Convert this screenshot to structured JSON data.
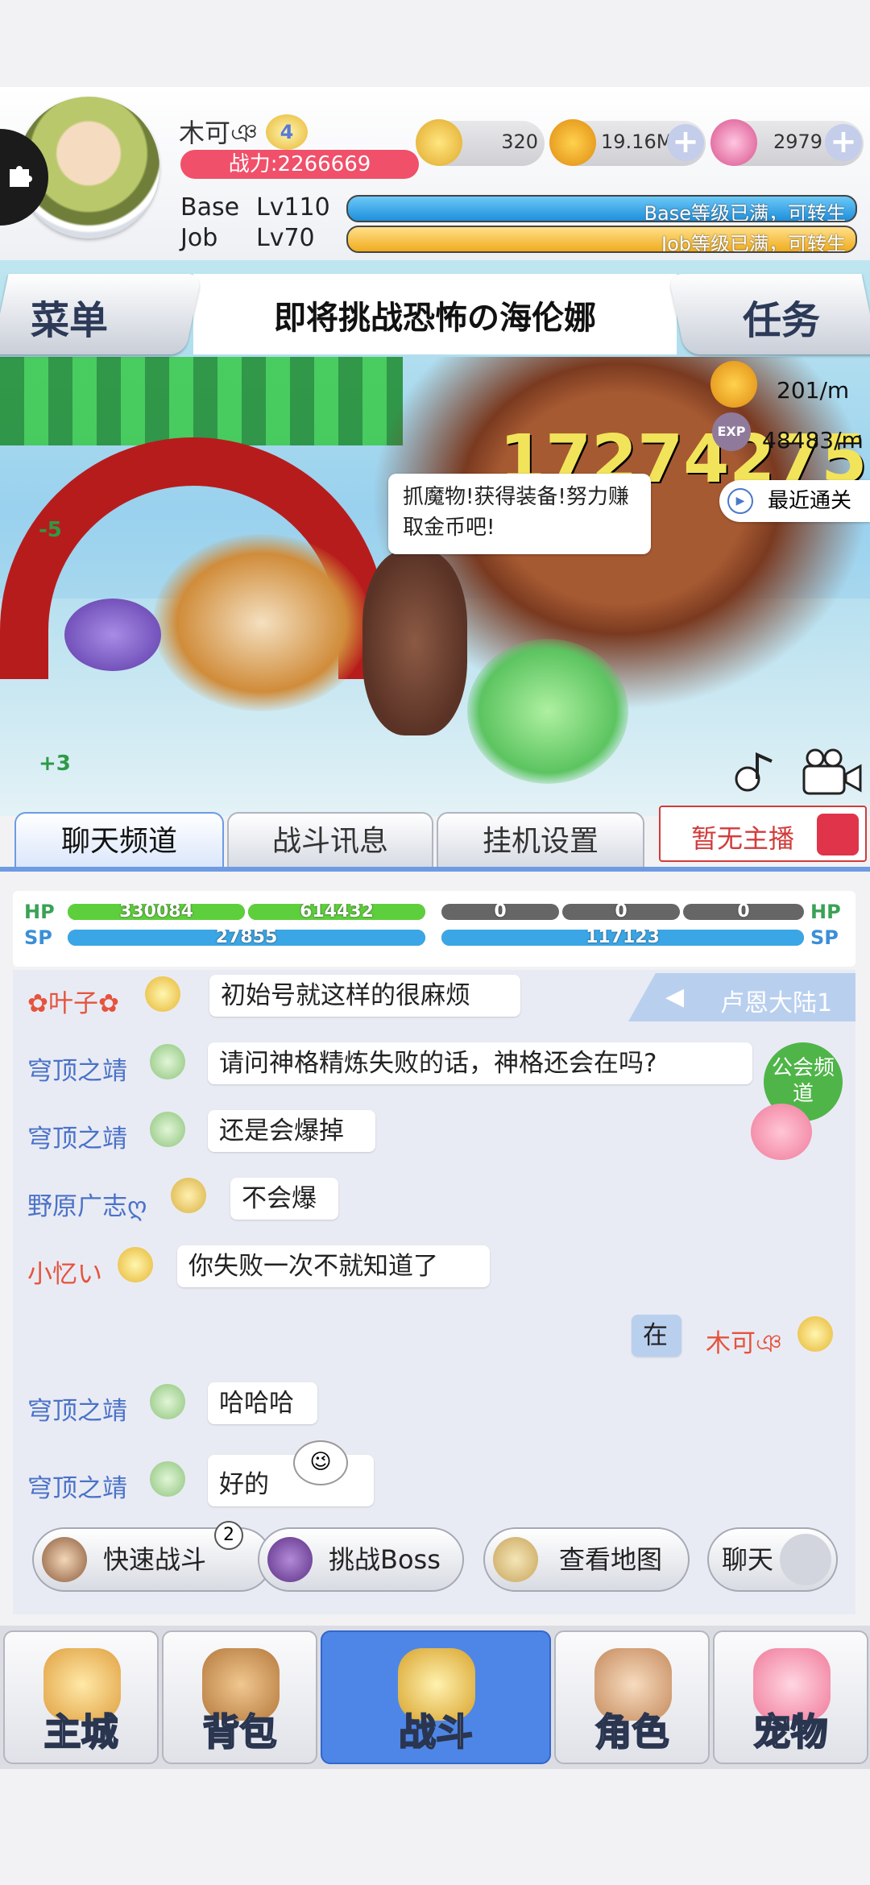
{
  "player": {
    "name": "木可ঞ",
    "vip": "4",
    "power": "战力:2266669",
    "base_label": "Base",
    "base_level": "Lv110",
    "base_status": "Base等级已满，可转生",
    "job_label": "Job",
    "job_level": "Lv70",
    "job_status": "Job等级已满，可转生"
  },
  "resources": {
    "zeny_a": "320",
    "gold": "19.16M",
    "gems": "2979"
  },
  "battle": {
    "menu_label": "菜单",
    "title": "即将挑战恐怖の海伦娜",
    "task_label": "任务",
    "gold_rate": "201/m",
    "exp_icon": "EXP",
    "exp_rate": "48483/m",
    "damage_text": "17274275",
    "speech": "抓魔物!获得装备!努力赚取金币吧!",
    "recent_clear": "最近通关",
    "left_num_top": "-5",
    "left_num_bottom": "+3"
  },
  "tabs": [
    {
      "label": "聊天频道",
      "active": true
    },
    {
      "label": "战斗讯息",
      "active": false
    },
    {
      "label": "挂机设置",
      "active": false
    }
  ],
  "broadcast_label": "暂无主播",
  "stats": {
    "hp_label": "HP",
    "sp_label": "SP",
    "hp_1": "330084",
    "hp_2": "614432",
    "hp_3": "0",
    "hp_4": "0",
    "hp_5": "0",
    "sp_1": "27855",
    "sp_2": "117123"
  },
  "chat": {
    "region": "卢恩大陆1",
    "guild_channel": "公会频道",
    "messages": [
      {
        "sender": "✿叶子✿",
        "text": "初始号就这样的很麻烦",
        "color": "#e5533d"
      },
      {
        "sender": "穹顶之靖",
        "text": "请问神格精炼失败的话，神格还会在吗?",
        "color": "#4a72c8"
      },
      {
        "sender": "穹顶之靖",
        "text": "还是会爆掉",
        "color": "#4a72c8"
      },
      {
        "sender": "野原广志ღ",
        "text": "不会爆",
        "color": "#4a72c8"
      },
      {
        "sender": "小忆い",
        "text": "你失败一次不就知道了",
        "color": "#e5533d"
      },
      {
        "sender": "木可ঞ",
        "text": "在",
        "color": "#e5533d"
      },
      {
        "sender": "穹顶之靖",
        "text": "哈哈哈",
        "color": "#4a72c8"
      },
      {
        "sender": "穹顶之靖",
        "text": "好的",
        "color": "#4a72c8"
      }
    ]
  },
  "actions": {
    "quick_battle": "快速战斗",
    "quick_badge": "2",
    "boss": "挑战Boss",
    "map": "查看地图",
    "chat": "聊天"
  },
  "nav": [
    {
      "label": "主城"
    },
    {
      "label": "背包"
    },
    {
      "label": "战斗",
      "active": true
    },
    {
      "label": "角色"
    },
    {
      "label": "宠物"
    }
  ]
}
